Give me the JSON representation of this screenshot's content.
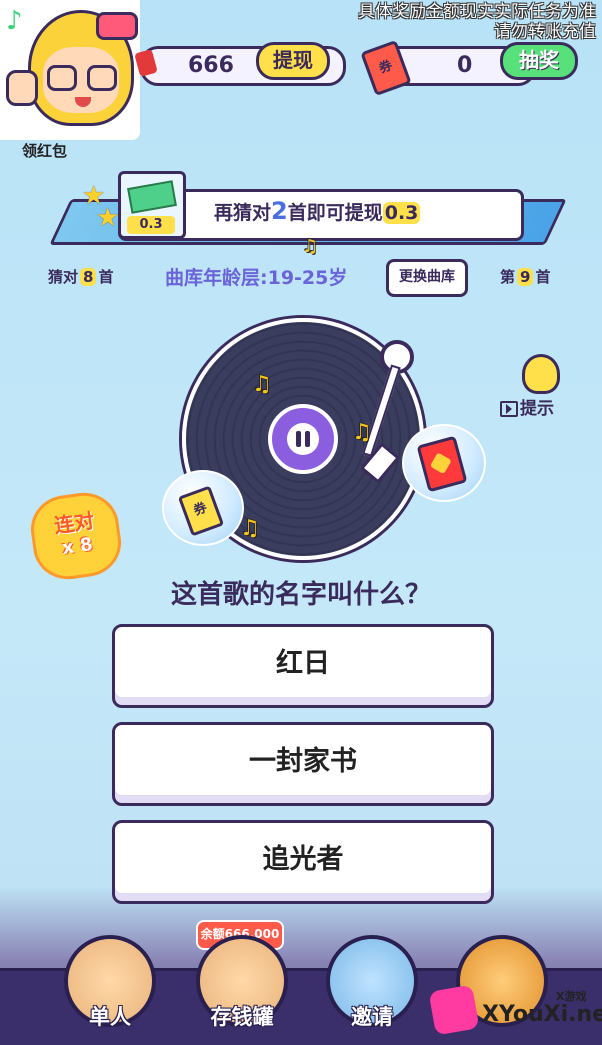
{
  "notice": {
    "line1": "具体奖励金额现实实际任务为准",
    "line2": "请勿转账充值"
  },
  "avatar": {
    "label": "领红包"
  },
  "topbar": {
    "coins": "666",
    "withdraw_label": "提现",
    "ticket_icon": "券",
    "tickets": "0",
    "lottery_label": "抽奖"
  },
  "progress": {
    "reward_amount": "0.3",
    "msg_prefix": "再猜对",
    "remaining": "2",
    "msg_suffix": "首即可提现",
    "withdraw_amount": "0.3"
  },
  "stats": {
    "correct_prefix": "猜对",
    "correct_count": "8",
    "correct_suffix": "首",
    "age_range": "曲库年龄层:19-25岁",
    "switch_library": "更换曲库",
    "song_prefix": "第",
    "song_number": "9",
    "song_suffix": "首"
  },
  "player": {
    "ticket_bubble": "券"
  },
  "hint": {
    "label": "提示"
  },
  "combo": {
    "label": "连对",
    "count": "x 8"
  },
  "question": "这首歌的名字叫什么？",
  "answers": [
    "红日",
    "一封家书",
    "追光者"
  ],
  "nav": {
    "items": [
      {
        "label": "单人"
      },
      {
        "label": "存钱罐"
      },
      {
        "label": "邀请"
      },
      {
        "label": ""
      }
    ],
    "balance_tag": "余额666.000"
  },
  "watermark": {
    "small": "X游戏",
    "big": "XYouXi.net"
  },
  "colors": {
    "accent": "#6b63d8",
    "outline": "#3a2b5c",
    "yellow": "#ffe04a",
    "green": "#58e07a"
  }
}
